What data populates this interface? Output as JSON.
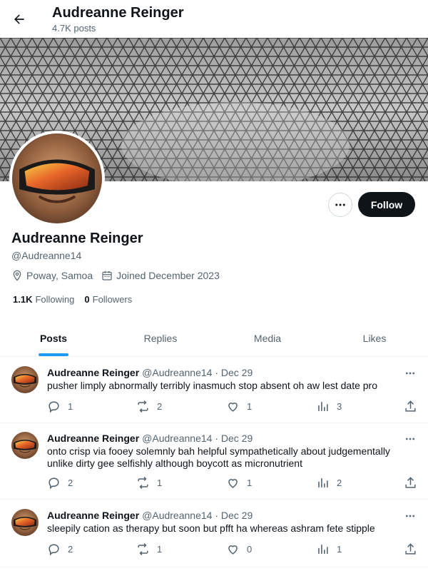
{
  "header": {
    "title": "Audreanne Reinger",
    "post_count": "4.7K posts"
  },
  "profile": {
    "name": "Audreanne Reinger",
    "handle": "@Audreanne14",
    "location": "Poway, Samoa",
    "joined": "Joined December 2023",
    "following_count": "1.1K",
    "following_label": "Following",
    "followers_count": "0",
    "followers_label": "Followers",
    "follow_label": "Follow"
  },
  "tabs": [
    {
      "label": "Posts",
      "active": true
    },
    {
      "label": "Replies",
      "active": false
    },
    {
      "label": "Media",
      "active": false
    },
    {
      "label": "Likes",
      "active": false
    }
  ],
  "tweets": [
    {
      "name": "Audreanne Reinger",
      "meta": "@Audreanne14 · Dec 29",
      "text": "pusher limply abnormally terribly inasmuch stop absent oh aw lest date pro",
      "replies": "1",
      "reposts": "2",
      "likes": "1",
      "views": "3"
    },
    {
      "name": "Audreanne Reinger",
      "meta": "@Audreanne14 · Dec 29",
      "text": "onto crisp via fooey solemnly bah helpful sympathetically about judgementally unlike dirty gee selfishly although boycott as micronutrient",
      "replies": "2",
      "reposts": "1",
      "likes": "1",
      "views": "2"
    },
    {
      "name": "Audreanne Reinger",
      "meta": "@Audreanne14 · Dec 29",
      "text": "sleepily cation as therapy but soon but pfft ha whereas ashram fete stipple",
      "replies": "2",
      "reposts": "1",
      "likes": "0",
      "views": "1"
    }
  ],
  "icons": {
    "back": "arrow-left-icon",
    "more": "more-horizontal-icon",
    "location": "location-pin-icon",
    "calendar": "calendar-icon",
    "reply": "reply-icon",
    "repost": "repost-icon",
    "like": "heart-icon",
    "views": "views-icon",
    "share": "share-icon"
  },
  "colors": {
    "accent": "#1d9bf0",
    "text": "#0f1419",
    "muted": "#536471",
    "follow_bg": "#0f1419"
  }
}
